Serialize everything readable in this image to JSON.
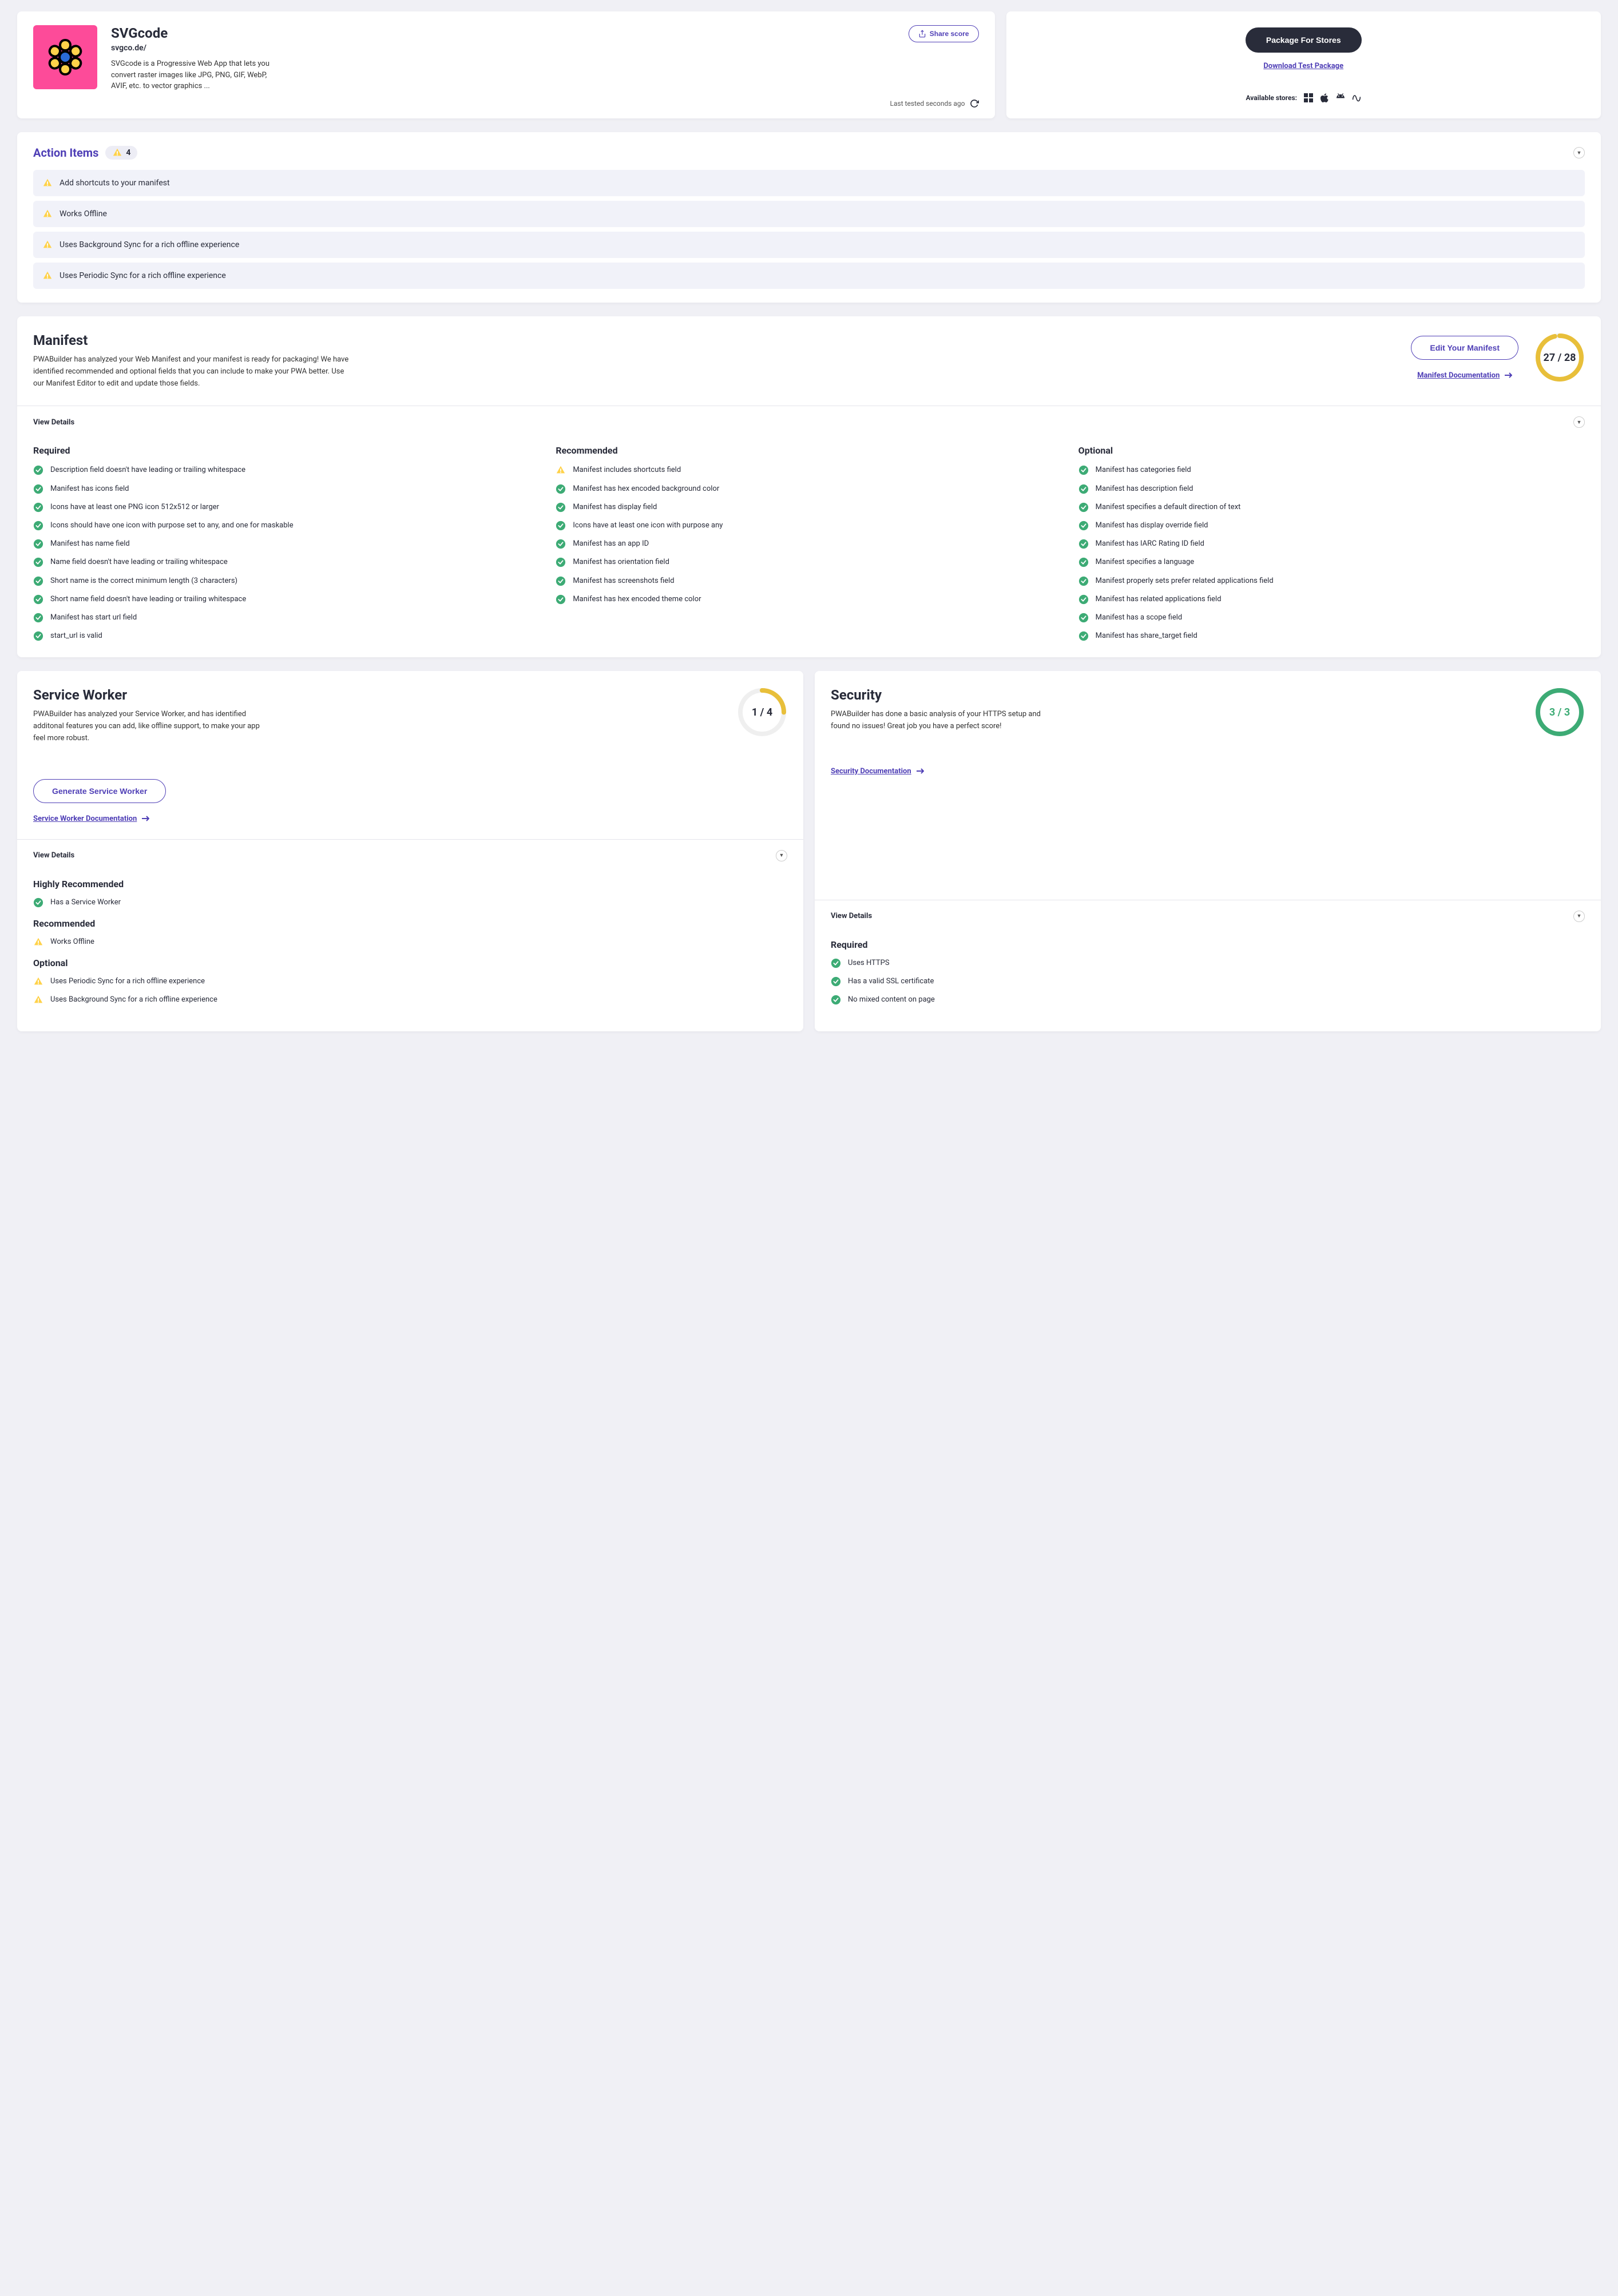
{
  "app": {
    "name": "SVGcode",
    "url": "svgco.de/",
    "description": "SVGcode is a Progressive Web App that lets you convert raster images like JPG, PNG, GIF, WebP, AVIF, etc. to vector graphics ...",
    "share_label": "Share score",
    "last_tested": "Last tested seconds ago"
  },
  "store": {
    "package_btn": "Package For Stores",
    "download_link": "Download Test Package",
    "available_label": "Available stores:"
  },
  "action_items": {
    "title": "Action Items",
    "count": "4",
    "items": [
      "Add shortcuts to your manifest",
      "Works Offline",
      "Uses Background Sync for a rich offline experience",
      "Uses Periodic Sync for a rich offline experience"
    ]
  },
  "manifest": {
    "title": "Manifest",
    "desc": "PWABuilder has analyzed your Web Manifest and your manifest is ready for packaging! We have identified recommended and optional fields that you can include to make your PWA better. Use our Manifest Editor to edit and update those fields.",
    "edit_btn": "Edit Your Manifest",
    "doc_link": "Manifest Documentation",
    "score": "27 / 28",
    "view_details": "View Details",
    "cols": {
      "required": {
        "title": "Required",
        "items": [
          "Description field doesn't have leading or trailing whitespace",
          "Manifest has icons field",
          "Icons have at least one PNG icon 512x512 or larger",
          "Icons should have one icon with purpose set to any, and one for maskable",
          "Manifest has name field",
          "Name field doesn't have leading or trailing whitespace",
          "Short name is the correct minimum length (3 characters)",
          "Short name field doesn't have leading or trailing whitespace",
          "Manifest has start url field",
          "start_url is valid"
        ]
      },
      "recommended": {
        "title": "Recommended",
        "items": [
          {
            "t": "Manifest includes shortcuts field",
            "s": "warn"
          },
          {
            "t": "Manifest has hex encoded background color",
            "s": "ok"
          },
          {
            "t": "Manifest has display field",
            "s": "ok"
          },
          {
            "t": "Icons have at least one icon with purpose any",
            "s": "ok"
          },
          {
            "t": "Manifest has an app ID",
            "s": "ok"
          },
          {
            "t": "Manifest has orientation field",
            "s": "ok"
          },
          {
            "t": "Manifest has screenshots field",
            "s": "ok"
          },
          {
            "t": "Manifest has hex encoded theme color",
            "s": "ok"
          }
        ]
      },
      "optional": {
        "title": "Optional",
        "items": [
          "Manifest has categories field",
          "Manifest has description field",
          "Manifest specifies a default direction of text",
          "Manifest has display override field",
          "Manifest has IARC Rating ID field",
          "Manifest specifies a language",
          "Manifest properly sets prefer related applications field",
          "Manifest has related applications field",
          "Manifest has a scope field",
          "Manifest has share_target field"
        ]
      }
    }
  },
  "sw": {
    "title": "Service Worker",
    "desc": "PWABuilder has analyzed your Service Worker, and has identified additonal features you can add, like offline support, to make your app feel more robust.",
    "score": "1 / 4",
    "gen_btn": "Generate Service Worker",
    "doc_link": "Service Worker Documentation",
    "view_details": "View Details",
    "cats": {
      "h_rec": {
        "title": "Highly Recommended",
        "items": [
          {
            "t": "Has a Service Worker",
            "s": "ok"
          }
        ]
      },
      "rec": {
        "title": "Recommended",
        "items": [
          {
            "t": "Works Offline",
            "s": "warn"
          }
        ]
      },
      "opt": {
        "title": "Optional",
        "items": [
          {
            "t": "Uses Periodic Sync for a rich offline experience",
            "s": "warn"
          },
          {
            "t": "Uses Background Sync for a rich offline experience",
            "s": "warn"
          }
        ]
      }
    }
  },
  "security": {
    "title": "Security",
    "desc": "PWABuilder has done a basic analysis of your HTTPS setup and found no issues! Great job you have a perfect score!",
    "score": "3 / 3",
    "doc_link": "Security Documentation",
    "view_details": "View Details",
    "cats": {
      "req": {
        "title": "Required",
        "items": [
          {
            "t": "Uses HTTPS",
            "s": "ok"
          },
          {
            "t": "Has a valid SSL certificate",
            "s": "ok"
          },
          {
            "t": "No mixed content on page",
            "s": "ok"
          }
        ]
      }
    }
  }
}
